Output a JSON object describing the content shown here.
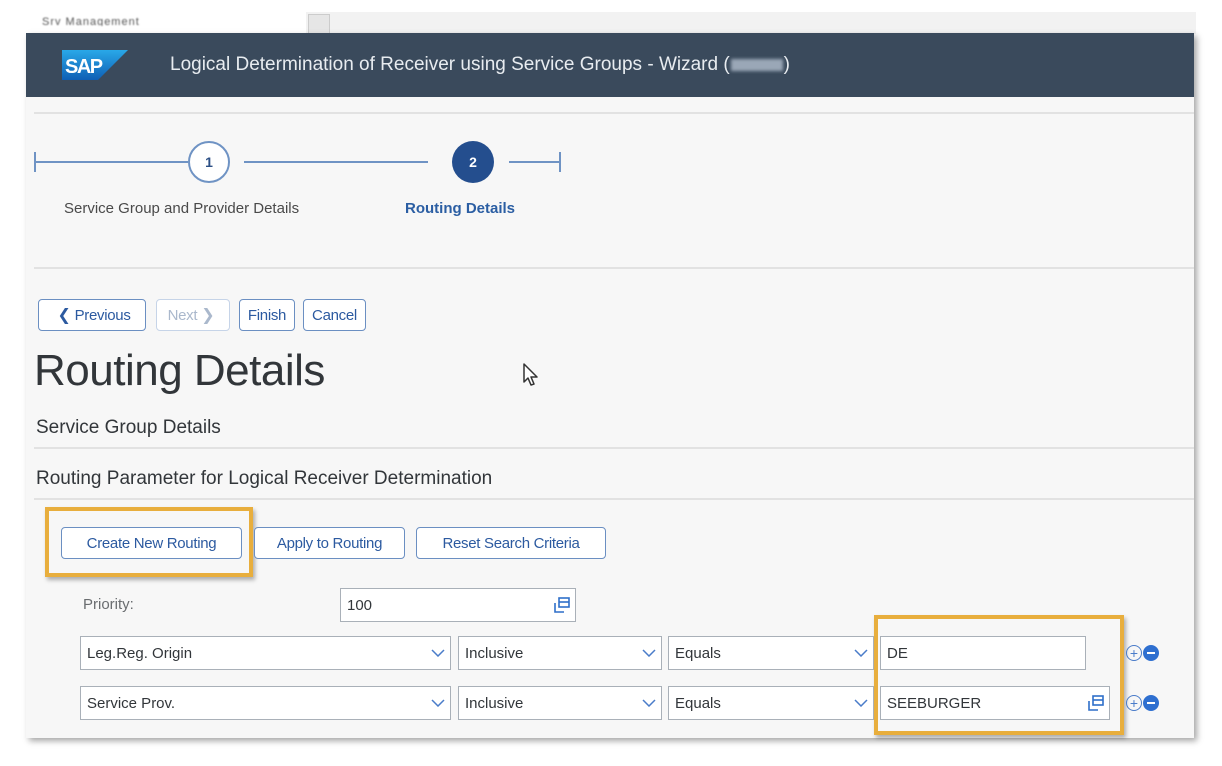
{
  "background_tab": {
    "label": "Srv Management"
  },
  "shell": {
    "logo": "SAP",
    "title_prefix": "Logical Determination of Receiver using Service Groups - Wizard (",
    "title_suffix": ")"
  },
  "wizard": {
    "steps": [
      {
        "number": "1",
        "label": "Service Group and Provider Details",
        "state": "completed"
      },
      {
        "number": "2",
        "label": "Routing Details",
        "state": "active"
      }
    ]
  },
  "nav_buttons": {
    "previous": "Previous",
    "next": "Next",
    "finish": "Finish",
    "cancel": "Cancel"
  },
  "page": {
    "title": "Routing Details",
    "sections": [
      "Service Group Details",
      "Routing Parameter for Logical Receiver Determination"
    ]
  },
  "routing_toolbar": {
    "create_new": "Create New Routing",
    "apply": "Apply to Routing",
    "reset": "Reset Search Criteria"
  },
  "form": {
    "priority_label": "Priority:",
    "priority_value": "100",
    "rows": [
      {
        "field": "Leg.Reg. Origin",
        "sign": "Inclusive",
        "option": "Equals",
        "value": "DE",
        "value_help": false
      },
      {
        "field": "Service Prov.",
        "sign": "Inclusive",
        "option": "Equals",
        "value": "SEEBURGER",
        "value_help": true
      }
    ]
  },
  "colors": {
    "shellbar": "#3a4a5c",
    "accent": "#244e8e",
    "button_text": "#2c5aa0",
    "highlight": "#e8ae3d"
  }
}
